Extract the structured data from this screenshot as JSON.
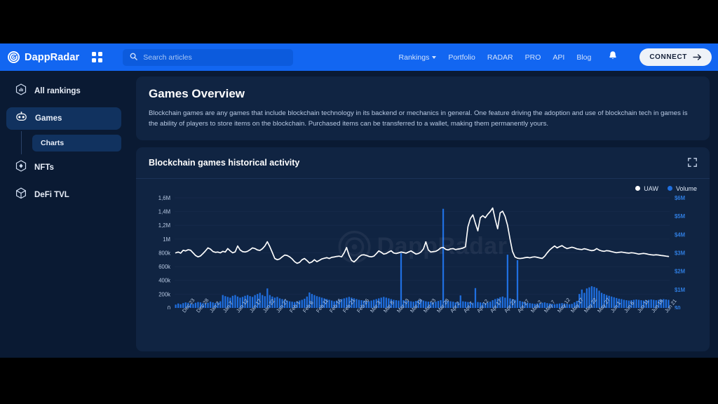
{
  "header": {
    "brand_name": "DappRadar",
    "logo_icon": "dappradar-radar-logo",
    "grid_icon": "apps-grid-icon",
    "search": {
      "placeholder": "Search articles",
      "value": "",
      "icon": "search-icon"
    },
    "nav": [
      {
        "label": "Rankings",
        "has_dropdown": true
      },
      {
        "label": "Portfolio",
        "has_dropdown": false
      },
      {
        "label": "RADAR",
        "has_dropdown": false
      },
      {
        "label": "PRO",
        "has_dropdown": false
      },
      {
        "label": "API",
        "has_dropdown": false
      },
      {
        "label": "Blog",
        "has_dropdown": false
      }
    ],
    "notification_icon": "bell-icon",
    "connect_label": "CONNECT",
    "connect_arrow_icon": "arrow-right-icon"
  },
  "sidebar": {
    "items": [
      {
        "label": "All rankings",
        "icon": "rankings-hexagon-icon",
        "active": false
      },
      {
        "label": "Games",
        "icon": "robot-icon",
        "active": true
      },
      {
        "label": "NFTs",
        "icon": "nft-hexagon-icon",
        "active": false
      },
      {
        "label": "DeFi TVL",
        "icon": "cube-icon",
        "active": false
      }
    ],
    "sub_item": {
      "label": "Charts",
      "active": true
    }
  },
  "overview": {
    "title": "Games Overview",
    "description": "Blockchain games are any games that include blockchain technology in its backend or mechanics in general. One feature driving the adoption and use of blockchain tech in games is the ability of players to store items on the blockchain. Purchased items can be transferred to a wallet, making them permanently yours."
  },
  "chart_card": {
    "title": "Blockchain games historical activity",
    "expand_icon": "fullscreen-expand-icon",
    "watermark_text": "DappRadar",
    "watermark_icon": "dappradar-radar-logo"
  },
  "colors": {
    "brand_blue": "#1266f1",
    "page_bg": "#0a1a33",
    "card_bg": "#102442",
    "uaw_line": "#ffffff",
    "volume_bar": "#1f6fe0",
    "right_axis_text": "#2f7de0",
    "left_axis_text": "#b6c7e0",
    "grid_line": "#16294a"
  },
  "chart_data": {
    "type": "line",
    "title": "Blockchain games historical activity",
    "xlabel": "",
    "ylabel": "UAW",
    "y2label": "Volume",
    "grid": true,
    "legend_position": "top-right",
    "ylim": [
      0,
      1600000
    ],
    "y2lim": [
      0,
      6000000
    ],
    "ytick_labels": [
      "0",
      "200k",
      "400k",
      "600k",
      "800k",
      "1M",
      "1,2M",
      "1,4M",
      "1,6M"
    ],
    "ytick_values": [
      0,
      200000,
      400000,
      600000,
      800000,
      1000000,
      1200000,
      1400000,
      1600000
    ],
    "y2tick_labels": [
      "$0",
      "$1M",
      "$2M",
      "$3M",
      "$4M",
      "$5M",
      "$6M"
    ],
    "y2tick_values": [
      0,
      1000000,
      2000000,
      3000000,
      4000000,
      5000000,
      6000000
    ],
    "xtick_labels": [
      "Dec 23",
      "Dec 28",
      "Jan 2",
      "Jan 7",
      "Jan 12",
      "Jan 17",
      "Jan 22",
      "Jan 27",
      "Feb 1",
      "Feb 6",
      "Feb 11",
      "Feb 16",
      "Feb 21",
      "Feb 26",
      "Mar 3",
      "Mar 8",
      "Mar 13",
      "Mar 18",
      "Mar 23",
      "Mar 28",
      "Apr 2",
      "Apr 7",
      "Apr 12",
      "Apr 17",
      "Apr 22",
      "Apr 27",
      "May 2",
      "May 7",
      "May 12",
      "May 17",
      "May 22",
      "May 27",
      "Jun 1",
      "Jun 6",
      "Jun 11",
      "Jun 16",
      "Jun 21"
    ],
    "series": [
      {
        "name": "UAW",
        "type": "line",
        "color": "#ffffff",
        "axis": "left",
        "values": [
          800000,
          812000,
          795000,
          838000,
          828000,
          845000,
          838000,
          800000,
          762000,
          742000,
          755000,
          790000,
          828000,
          872000,
          855000,
          820000,
          808000,
          812000,
          800000,
          822000,
          812000,
          862000,
          828000,
          800000,
          815000,
          900000,
          842000,
          818000,
          812000,
          822000,
          845000,
          872000,
          862000,
          842000,
          835000,
          860000,
          900000,
          962000,
          890000,
          805000,
          718000,
          700000,
          712000,
          742000,
          768000,
          762000,
          742000,
          712000,
          672000,
          648000,
          662000,
          700000,
          718000,
          688000,
          652000,
          668000,
          700000,
          672000,
          690000,
          712000,
          722000,
          730000,
          718000,
          735000,
          740000,
          748000,
          752000,
          742000,
          800000,
          878000,
          762000,
          690000,
          668000,
          700000,
          742000,
          768000,
          772000,
          762000,
          748000,
          742000,
          752000,
          788000,
          828000,
          808000,
          782000,
          790000,
          812000,
          830000,
          798000,
          790000,
          800000,
          812000,
          805000,
          795000,
          812000,
          828000,
          805000,
          782000,
          790000,
          812000,
          855000,
          960000,
          842000,
          812000,
          818000,
          822000,
          842000,
          872000,
          880000,
          852000,
          842000,
          858000,
          862000,
          848000,
          855000,
          860000,
          870000,
          888000,
          1180000,
          1300000,
          1352000,
          1230000,
          1120000,
          1310000,
          1340000,
          1310000,
          1360000,
          1400000,
          1452000,
          1290000,
          1150000,
          1380000,
          1405000,
          1330000,
          1200000,
          1000000,
          820000,
          740000,
          722000,
          718000,
          722000,
          730000,
          735000,
          728000,
          738000,
          742000,
          735000,
          726000,
          720000,
          752000,
          800000,
          842000,
          872000,
          900000,
          872000,
          890000,
          905000,
          880000,
          862000,
          872000,
          882000,
          872000,
          858000,
          852000,
          848000,
          860000,
          852000,
          840000,
          832000,
          838000,
          862000,
          840000,
          828000,
          822000,
          832000,
          828000,
          818000,
          810000,
          802000,
          808000,
          812000,
          806000,
          800000,
          796000,
          802000,
          798000,
          790000,
          782000,
          788000,
          792000,
          786000,
          778000,
          772000,
          768000,
          772000,
          768000,
          762000,
          758000,
          752000,
          748000
        ]
      },
      {
        "name": "Volume",
        "type": "bar",
        "color": "#1f6fe0",
        "axis": "right",
        "values": [
          180000,
          240000,
          200000,
          260000,
          300000,
          280000,
          240000,
          220000,
          280000,
          320000,
          300000,
          260000,
          240000,
          280000,
          340000,
          300000,
          260000,
          300000,
          360000,
          700000,
          640000,
          600000,
          560000,
          660000,
          700000,
          620000,
          560000,
          600000,
          660000,
          700000,
          640000,
          600000,
          700000,
          760000,
          820000,
          700000,
          640000,
          1060000,
          700000,
          620000,
          560000,
          600000,
          520000,
          480000,
          440000,
          400000,
          360000,
          340000,
          320000,
          360000,
          400000,
          440000,
          500000,
          620000,
          840000,
          760000,
          700000,
          640000,
          600000,
          560000,
          520000,
          480000,
          440000,
          400000,
          360000,
          400000,
          440000,
          480000,
          520000,
          560000,
          600000,
          560000,
          520000,
          480000,
          440000,
          420000,
          400000,
          380000,
          360000,
          400000,
          440000,
          480000,
          520000,
          560000,
          600000,
          560000,
          520000,
          480000,
          440000,
          420000,
          400000,
          2980000,
          420000,
          400000,
          380000,
          360000,
          340000,
          380000,
          420000,
          460000,
          400000,
          360000,
          340000,
          320000,
          300000,
          340000,
          380000,
          420000,
          5400000,
          400000,
          380000,
          360000,
          340000,
          300000,
          320000,
          680000,
          360000,
          340000,
          320000,
          300000,
          280000,
          1080000,
          320000,
          300000,
          280000,
          260000,
          300000,
          340000,
          420000,
          480000,
          520000,
          580000,
          620000,
          560000,
          2900000,
          520000,
          480000,
          440000,
          2600000,
          380000,
          340000,
          300000,
          280000,
          260000,
          240000,
          220000,
          240000,
          260000,
          280000,
          300000,
          260000,
          240000,
          220000,
          200000,
          220000,
          240000,
          260000,
          240000,
          220000,
          200000,
          220000,
          300000,
          380000,
          760000,
          1000000,
          820000,
          1060000,
          1120000,
          1180000,
          1140000,
          1080000,
          940000,
          820000,
          760000,
          700000,
          660000,
          620000,
          580000,
          540000,
          500000,
          480000,
          440000,
          420000,
          400000,
          420000,
          440000,
          460000,
          440000,
          420000,
          400000,
          420000,
          440000,
          460000,
          440000,
          420000,
          440000,
          460000,
          480000,
          460000,
          440000
        ]
      }
    ]
  }
}
